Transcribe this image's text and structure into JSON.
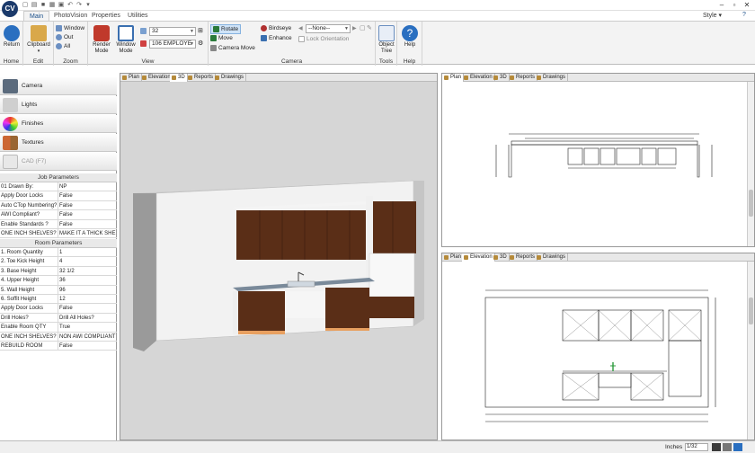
{
  "app": {
    "logo": "CV",
    "style_menu": "Style"
  },
  "tabs": [
    "Main",
    "PhotoVision",
    "Properties",
    "Utilities"
  ],
  "ribbon": {
    "return_label": "Return",
    "clipboard_label": "Clipboard",
    "zoom_window": "Window",
    "zoom_out": "Out",
    "zoom_all": "All",
    "render_mode": "Render Mode",
    "window_mode": "Window Mode",
    "zoom_value": "32",
    "layer_value": "106 EMPLOYE",
    "rotate": "Rotate",
    "move": "Move",
    "camera_move": "Camera Move",
    "birdseye": "Birdseye",
    "enhance": "Enhance",
    "none_select": "--None--",
    "lock_orientation": "Lock Orientation",
    "object_tree": "Object Tree",
    "help": "Help",
    "groups": {
      "home": "Home",
      "edit": "Edit",
      "zoom": "Zoom",
      "view": "View",
      "camera": "Camera",
      "tools": "Tools",
      "help": "Help"
    }
  },
  "nav": [
    "Camera",
    "Lights",
    "Finishes",
    "Textures",
    "CAD (F7)"
  ],
  "job_parameters": {
    "title": "Job Parameters",
    "rows": [
      [
        "01 Drawn By:",
        "NP"
      ],
      [
        "Apply Door Locks",
        "False"
      ],
      [
        "Auto CTop Numbering?",
        "False"
      ],
      [
        "AWI Compliant?",
        "False"
      ],
      [
        "Enable Standards ?",
        "False"
      ],
      [
        "ONE INCH SHELVES?",
        "MAKE IT A THICK SHE"
      ]
    ]
  },
  "room_parameters": {
    "title": "Room Parameters",
    "rows": [
      [
        "1. Room Quantity",
        "1"
      ],
      [
        "2. Toe Kick Height",
        "4"
      ],
      [
        "3. Base Height",
        "32 1/2"
      ],
      [
        "4. Upper Height",
        "36"
      ],
      [
        "5. Wall Height",
        "96"
      ],
      [
        "6. Soffit Height",
        "12"
      ],
      [
        "Apply Door Locks",
        "False"
      ],
      [
        "Drill Holes?",
        "Drill All Holes?"
      ],
      [
        "Enable Room QTY",
        "True"
      ],
      [
        "ONE INCH SHELVES?",
        "NON AWI COMPLIANT"
      ],
      [
        "REBUILD ROOM",
        "False"
      ]
    ]
  },
  "view_tabs": [
    "Plan",
    "Elevation",
    "3D",
    "Reports",
    "Drawings"
  ],
  "views": {
    "view1_active": "3D",
    "view2_active": "Plan",
    "view3_active": "Elevation"
  },
  "status": {
    "units": "Inches",
    "scale": "1/32"
  },
  "colors": {
    "ribbon_bg": "#f3f3f3",
    "accent": "#1a4f8a",
    "cabinet": "#5a2e17",
    "wall": "#f0f0f0"
  }
}
